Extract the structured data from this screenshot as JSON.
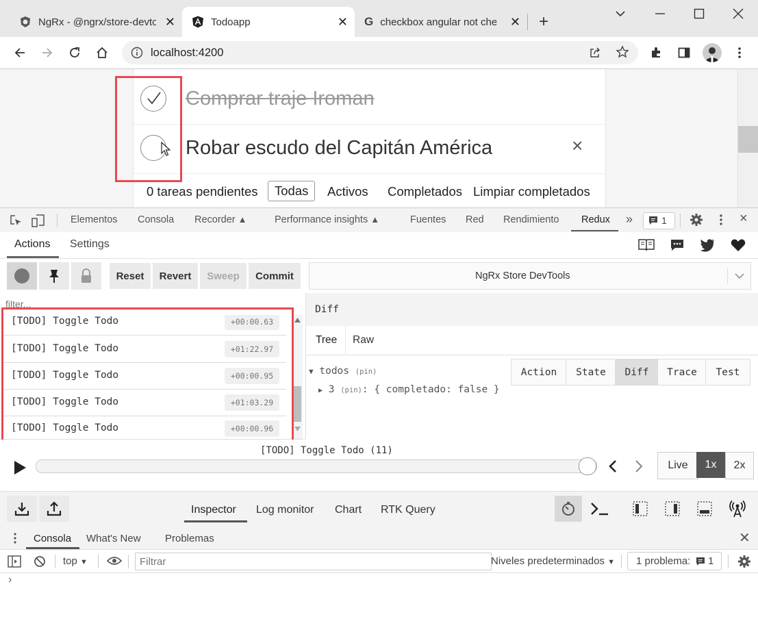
{
  "browser": {
    "tabs": [
      {
        "title": "NgRx - @ngrx/store-devtools",
        "icon": "ngrx-favicon-icon"
      },
      {
        "title": "Todoapp",
        "icon": "angular-favicon-icon"
      },
      {
        "title": "checkbox angular not checked",
        "icon": "google-favicon-icon"
      }
    ],
    "url": "localhost:4200"
  },
  "app": {
    "todos": [
      {
        "text": "Comprar traje Iroman",
        "completed": true
      },
      {
        "text": "Robar escudo del Capitán América",
        "completed": false,
        "delete": "×"
      }
    ],
    "footer": {
      "pending": "0 tareas pendientes",
      "filters": [
        "Todas",
        "Activos",
        "Completados"
      ],
      "active_filter": "Todas",
      "clear": "Limpiar completados"
    }
  },
  "devtools": {
    "tabs": [
      "Elementos",
      "Consola",
      "Recorder",
      "Performance insights",
      "Fuentes",
      "Red",
      "Rendimiento",
      "Redux"
    ],
    "active_tab": "Redux",
    "more": "»",
    "issues_badge": "1",
    "close": "×"
  },
  "redux": {
    "subtabs": [
      "Actions",
      "Settings"
    ],
    "buttons": {
      "reset": "Reset",
      "revert": "Revert",
      "sweep": "Sweep",
      "commit": "Commit"
    },
    "instance": "NgRx Store DevTools",
    "filter_placeholder": "filter...",
    "actions": [
      {
        "name": "[TODO] Toggle Todo",
        "time": "+00:00.63"
      },
      {
        "name": "[TODO] Toggle Todo",
        "time": "+01:22.97"
      },
      {
        "name": "[TODO] Toggle Todo",
        "time": "+00:00.95"
      },
      {
        "name": "[TODO] Toggle Todo",
        "time": "+01:03.29"
      },
      {
        "name": "[TODO] Toggle Todo",
        "time": "+00:00.96"
      }
    ],
    "panel_title": "Diff",
    "view_buttons": [
      "Action",
      "State",
      "Diff",
      "Trace",
      "Test"
    ],
    "active_view": "Diff",
    "format_tabs": [
      "Tree",
      "Raw"
    ],
    "tree": {
      "root_key": "todos",
      "root_pin": "(pin)",
      "child_key": "3",
      "child_pin": "(pin)",
      "child_value": "{ completado: false }"
    },
    "slider": {
      "label": "[TODO] Toggle Todo (11)",
      "position": 1.0,
      "live": "Live",
      "speeds": [
        "1x",
        "2x"
      ],
      "active_speed": "1x"
    },
    "bottom_tabs": [
      "Inspector",
      "Log monitor",
      "Chart",
      "RTK Query"
    ],
    "active_bottom_tab": "Inspector"
  },
  "console": {
    "tabs": [
      "Consola",
      "What's New",
      "Problemas"
    ],
    "active_tab": "Consola",
    "context": "top",
    "filter_placeholder": "Filtrar",
    "levels": "Niveles predeterminados",
    "issues": "1 problema:",
    "issues_count": "1",
    "prompt": "›"
  },
  "colors": {
    "highlight": "#e84a4f",
    "active_speed_bg": "#555555",
    "tab_strip": "#e8e8e8"
  }
}
